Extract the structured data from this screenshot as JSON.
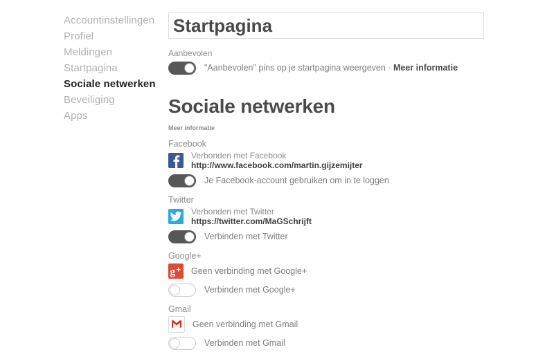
{
  "sidebar": {
    "items": [
      {
        "label": "Accountinstellingen",
        "active": false
      },
      {
        "label": "Profiel",
        "active": false
      },
      {
        "label": "Meldingen",
        "active": false
      },
      {
        "label": "Startpagina",
        "active": false
      },
      {
        "label": "Sociale netwerken",
        "active": true
      },
      {
        "label": "Beveiliging",
        "active": false
      },
      {
        "label": "Apps",
        "active": false
      }
    ]
  },
  "header": {
    "title": "Startpagina"
  },
  "aanbevolen": {
    "label": "Aanbevolen",
    "toggle_state": "on",
    "description": "\"Aanbevolen\" pins op je startpagina weergeven · ",
    "link_label": "Meer informatie"
  },
  "social": {
    "heading": "Sociale netwerken",
    "more_info": "Meer informatie",
    "networks": [
      {
        "name": "Facebook",
        "icon": "facebook-icon",
        "icon_color": "#3b5998",
        "connected": true,
        "status": "Verbonden met Facebook",
        "url": "http://www.facebook.com/martin.gijzemijter",
        "toggle_state": "on",
        "toggle_label": "Je Facebook-account gebruiken om in te loggen"
      },
      {
        "name": "Twitter",
        "icon": "twitter-icon",
        "icon_color": "#2ca8e0",
        "connected": true,
        "status": "Verbonden met Twitter",
        "url": "https://twitter.com/MaGSchrijft",
        "toggle_state": "on",
        "toggle_label": "Verbinden met Twitter"
      },
      {
        "name": "Google+",
        "icon": "googleplus-icon",
        "icon_color": "#dd4b39",
        "connected": false,
        "status": "Geen verbinding met Google+",
        "url": "",
        "toggle_state": "off",
        "toggle_label": "Verbinden met Google+"
      },
      {
        "name": "Gmail",
        "icon": "gmail-icon",
        "icon_color": "#d93025",
        "connected": false,
        "status": "Geen verbinding met Gmail",
        "url": "",
        "toggle_state": "off",
        "toggle_label": "Verbinden met Gmail"
      }
    ]
  }
}
